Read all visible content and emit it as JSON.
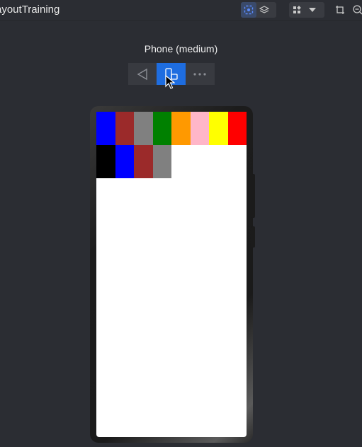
{
  "window": {
    "title": "ayoutTraining"
  },
  "toolbar": {
    "icons": [
      "inspector-icon",
      "layers-icon",
      "widgets-icon",
      "dropdown-icon",
      "crop-icon",
      "zoom-icon"
    ]
  },
  "preview": {
    "device_label": "Phone (medium)",
    "controls": [
      "back-icon",
      "device-rotate-icon",
      "more-icon"
    ]
  },
  "content": {
    "cell_colors": [
      "#0000ff",
      "#9b2a2a",
      "#808080",
      "#008000",
      "#ff9900",
      "#ffb6c8",
      "#ffff00",
      "#ff0000",
      "#000000",
      "#0000ff",
      "#9b2a2a",
      "#808080"
    ]
  },
  "colors": {
    "background": "#2b2d33",
    "accent": "#1e6de0",
    "screen": "#ffffff"
  }
}
